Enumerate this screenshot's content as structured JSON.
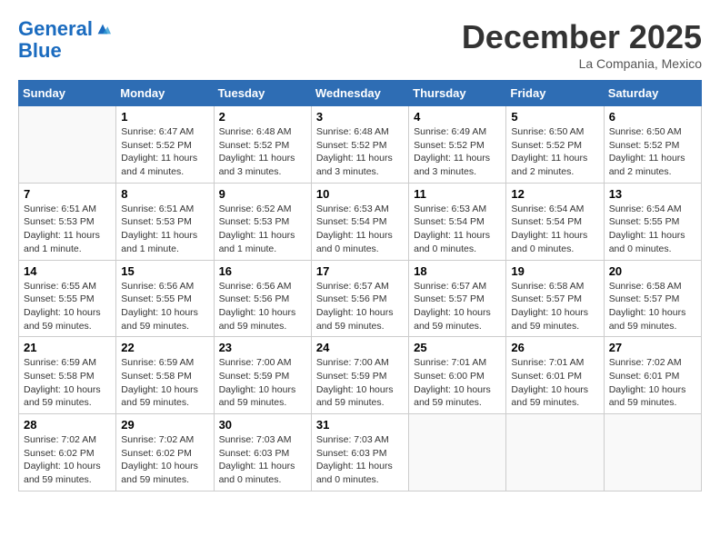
{
  "logo": {
    "line1": "General",
    "line2": "Blue"
  },
  "title": "December 2025",
  "location": "La Compania, Mexico",
  "days_of_week": [
    "Sunday",
    "Monday",
    "Tuesday",
    "Wednesday",
    "Thursday",
    "Friday",
    "Saturday"
  ],
  "weeks": [
    [
      {
        "day": "",
        "info": ""
      },
      {
        "day": "1",
        "info": "Sunrise: 6:47 AM\nSunset: 5:52 PM\nDaylight: 11 hours\nand 4 minutes."
      },
      {
        "day": "2",
        "info": "Sunrise: 6:48 AM\nSunset: 5:52 PM\nDaylight: 11 hours\nand 3 minutes."
      },
      {
        "day": "3",
        "info": "Sunrise: 6:48 AM\nSunset: 5:52 PM\nDaylight: 11 hours\nand 3 minutes."
      },
      {
        "day": "4",
        "info": "Sunrise: 6:49 AM\nSunset: 5:52 PM\nDaylight: 11 hours\nand 3 minutes."
      },
      {
        "day": "5",
        "info": "Sunrise: 6:50 AM\nSunset: 5:52 PM\nDaylight: 11 hours\nand 2 minutes."
      },
      {
        "day": "6",
        "info": "Sunrise: 6:50 AM\nSunset: 5:52 PM\nDaylight: 11 hours\nand 2 minutes."
      }
    ],
    [
      {
        "day": "7",
        "info": "Sunrise: 6:51 AM\nSunset: 5:53 PM\nDaylight: 11 hours\nand 1 minute."
      },
      {
        "day": "8",
        "info": "Sunrise: 6:51 AM\nSunset: 5:53 PM\nDaylight: 11 hours\nand 1 minute."
      },
      {
        "day": "9",
        "info": "Sunrise: 6:52 AM\nSunset: 5:53 PM\nDaylight: 11 hours\nand 1 minute."
      },
      {
        "day": "10",
        "info": "Sunrise: 6:53 AM\nSunset: 5:54 PM\nDaylight: 11 hours\nand 0 minutes."
      },
      {
        "day": "11",
        "info": "Sunrise: 6:53 AM\nSunset: 5:54 PM\nDaylight: 11 hours\nand 0 minutes."
      },
      {
        "day": "12",
        "info": "Sunrise: 6:54 AM\nSunset: 5:54 PM\nDaylight: 11 hours\nand 0 minutes."
      },
      {
        "day": "13",
        "info": "Sunrise: 6:54 AM\nSunset: 5:55 PM\nDaylight: 11 hours\nand 0 minutes."
      }
    ],
    [
      {
        "day": "14",
        "info": "Sunrise: 6:55 AM\nSunset: 5:55 PM\nDaylight: 10 hours\nand 59 minutes."
      },
      {
        "day": "15",
        "info": "Sunrise: 6:56 AM\nSunset: 5:55 PM\nDaylight: 10 hours\nand 59 minutes."
      },
      {
        "day": "16",
        "info": "Sunrise: 6:56 AM\nSunset: 5:56 PM\nDaylight: 10 hours\nand 59 minutes."
      },
      {
        "day": "17",
        "info": "Sunrise: 6:57 AM\nSunset: 5:56 PM\nDaylight: 10 hours\nand 59 minutes."
      },
      {
        "day": "18",
        "info": "Sunrise: 6:57 AM\nSunset: 5:57 PM\nDaylight: 10 hours\nand 59 minutes."
      },
      {
        "day": "19",
        "info": "Sunrise: 6:58 AM\nSunset: 5:57 PM\nDaylight: 10 hours\nand 59 minutes."
      },
      {
        "day": "20",
        "info": "Sunrise: 6:58 AM\nSunset: 5:57 PM\nDaylight: 10 hours\nand 59 minutes."
      }
    ],
    [
      {
        "day": "21",
        "info": "Sunrise: 6:59 AM\nSunset: 5:58 PM\nDaylight: 10 hours\nand 59 minutes."
      },
      {
        "day": "22",
        "info": "Sunrise: 6:59 AM\nSunset: 5:58 PM\nDaylight: 10 hours\nand 59 minutes."
      },
      {
        "day": "23",
        "info": "Sunrise: 7:00 AM\nSunset: 5:59 PM\nDaylight: 10 hours\nand 59 minutes."
      },
      {
        "day": "24",
        "info": "Sunrise: 7:00 AM\nSunset: 5:59 PM\nDaylight: 10 hours\nand 59 minutes."
      },
      {
        "day": "25",
        "info": "Sunrise: 7:01 AM\nSunset: 6:00 PM\nDaylight: 10 hours\nand 59 minutes."
      },
      {
        "day": "26",
        "info": "Sunrise: 7:01 AM\nSunset: 6:01 PM\nDaylight: 10 hours\nand 59 minutes."
      },
      {
        "day": "27",
        "info": "Sunrise: 7:02 AM\nSunset: 6:01 PM\nDaylight: 10 hours\nand 59 minutes."
      }
    ],
    [
      {
        "day": "28",
        "info": "Sunrise: 7:02 AM\nSunset: 6:02 PM\nDaylight: 10 hours\nand 59 minutes."
      },
      {
        "day": "29",
        "info": "Sunrise: 7:02 AM\nSunset: 6:02 PM\nDaylight: 10 hours\nand 59 minutes."
      },
      {
        "day": "30",
        "info": "Sunrise: 7:03 AM\nSunset: 6:03 PM\nDaylight: 11 hours\nand 0 minutes."
      },
      {
        "day": "31",
        "info": "Sunrise: 7:03 AM\nSunset: 6:03 PM\nDaylight: 11 hours\nand 0 minutes."
      },
      {
        "day": "",
        "info": ""
      },
      {
        "day": "",
        "info": ""
      },
      {
        "day": "",
        "info": ""
      }
    ]
  ]
}
